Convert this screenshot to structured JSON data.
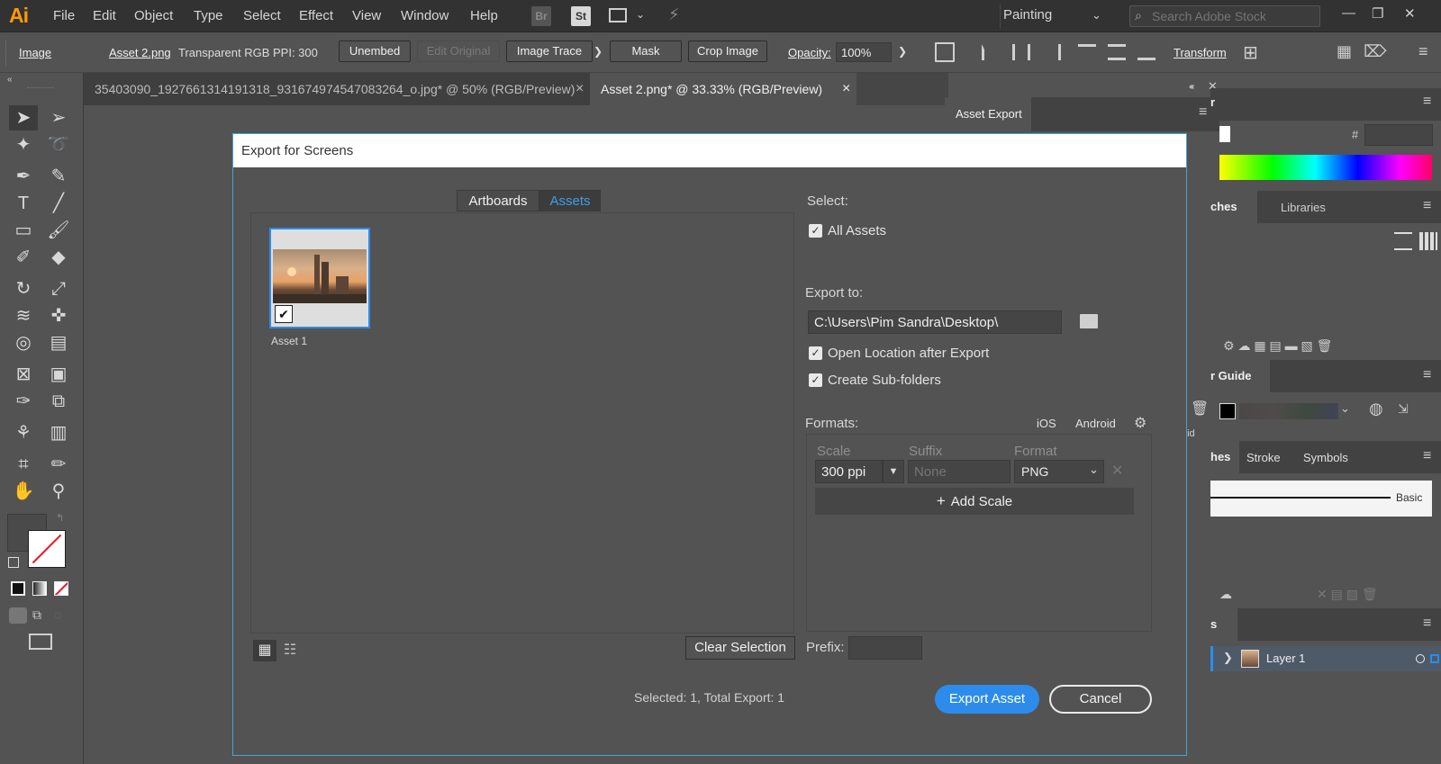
{
  "app": {
    "logo": "Ai"
  },
  "menubar": {
    "items": [
      "File",
      "Edit",
      "Object",
      "Type",
      "Select",
      "Effect",
      "View",
      "Window",
      "Help"
    ],
    "bridge": "Br",
    "stock": "St",
    "workspace": "Painting",
    "search_placeholder": "Search Adobe Stock"
  },
  "control_bar": {
    "object_type": "Image",
    "file_name": "Asset 2.png",
    "color_mode": "Transparent RGB",
    "ppi": "PPI: 300",
    "unembed": "Unembed",
    "edit_original": "Edit Original",
    "image_trace": "Image Trace",
    "mask": "Mask",
    "crop_image": "Crop Image",
    "opacity_label": "Opacity:",
    "opacity_value": "100%",
    "transform": "Transform"
  },
  "doc_tabs": [
    {
      "title": "35403090_1927661314191318_931674974547083264_o.jpg* @ 50% (RGB/Preview)"
    },
    {
      "title": "Asset 2.png* @ 33.33% (RGB/Preview)"
    }
  ],
  "asset_export_panel": {
    "title": "Asset Export"
  },
  "dialog": {
    "title": "Export for Screens",
    "tabs": [
      "Artboards",
      "Assets"
    ],
    "assets": [
      {
        "name": "Asset 1"
      }
    ],
    "select_label": "Select:",
    "all_assets": "All Assets",
    "export_to_label": "Export to:",
    "export_path": "C:\\Users\\Pim Sandra\\Desktop\\",
    "open_location": "Open Location after Export",
    "create_subfolders": "Create Sub-folders",
    "formats_label": "Formats:",
    "ios": "iOS",
    "android": "Android",
    "col_scale": "Scale",
    "col_suffix": "Suffix",
    "col_format": "Format",
    "scale_value": "300 ppi",
    "suffix_placeholder": "None",
    "format_value": "PNG",
    "add_scale": "Add Scale",
    "clear_selection": "Clear Selection",
    "prefix_label": "Prefix:",
    "status": "Selected: 1, Total Export: 1",
    "export_button": "Export Asset",
    "cancel_button": "Cancel"
  },
  "right_panels": {
    "color_partial": "r",
    "hash": "#",
    "swatches_partial": "ches",
    "libraries": "Libraries",
    "color_guide_partial": "r Guide",
    "android_partial": "oid",
    "brushes_partial": "hes",
    "stroke": "Stroke",
    "symbols": "Symbols",
    "brush_basic": "Basic",
    "layers_partial": "s",
    "layer_name": "Layer 1"
  },
  "colors": {
    "accent": "#2d8ceb",
    "dialog_border": "#3fa7d2",
    "logo": "#ff9a00"
  }
}
